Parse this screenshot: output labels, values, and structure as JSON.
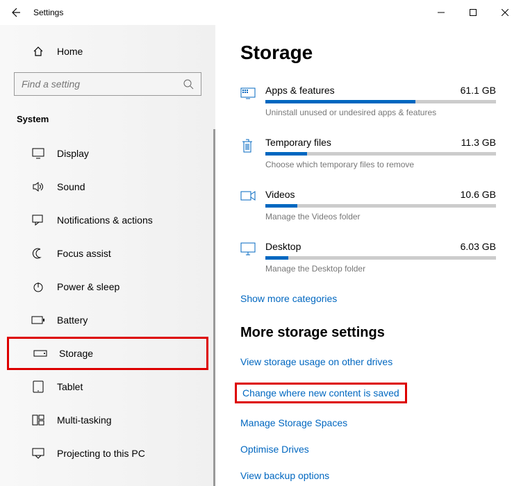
{
  "window": {
    "title": "Settings"
  },
  "sidebar": {
    "home": "Home",
    "search_placeholder": "Find a setting",
    "group": "System",
    "items": [
      {
        "label": "Display"
      },
      {
        "label": "Sound"
      },
      {
        "label": "Notifications & actions"
      },
      {
        "label": "Focus assist"
      },
      {
        "label": "Power & sleep"
      },
      {
        "label": "Battery"
      },
      {
        "label": "Storage"
      },
      {
        "label": "Tablet"
      },
      {
        "label": "Multi-tasking"
      },
      {
        "label": "Projecting to this PC"
      }
    ]
  },
  "main": {
    "title": "Storage",
    "items": [
      {
        "name": "Apps & features",
        "size": "61.1 GB",
        "desc": "Uninstall unused or undesired apps & features",
        "fill": 65
      },
      {
        "name": "Temporary files",
        "size": "11.3 GB",
        "desc": "Choose which temporary files to remove",
        "fill": 18
      },
      {
        "name": "Videos",
        "size": "10.6 GB",
        "desc": "Manage the Videos folder",
        "fill": 14
      },
      {
        "name": "Desktop",
        "size": "6.03 GB",
        "desc": "Manage the Desktop folder",
        "fill": 10
      }
    ],
    "show_more": "Show more categories",
    "more_title": "More storage settings",
    "links": [
      "View storage usage on other drives",
      "Change where new content is saved",
      "Manage Storage Spaces",
      "Optimise Drives",
      "View backup options"
    ]
  }
}
